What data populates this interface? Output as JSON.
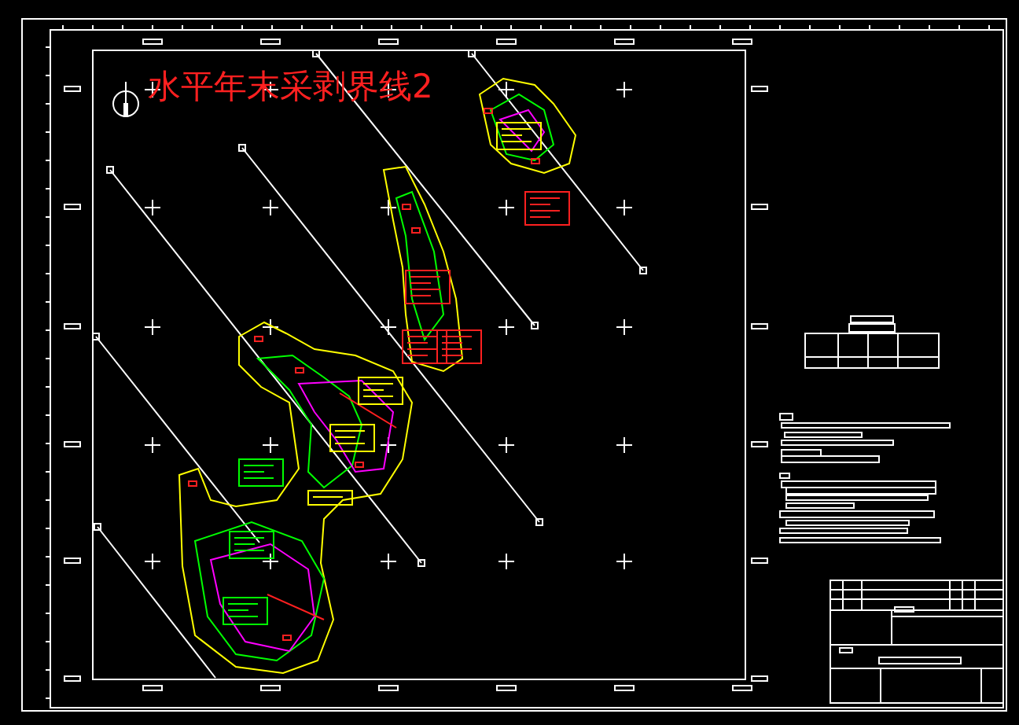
{
  "drawing": {
    "title": "水平年末采剥界线2"
  }
}
